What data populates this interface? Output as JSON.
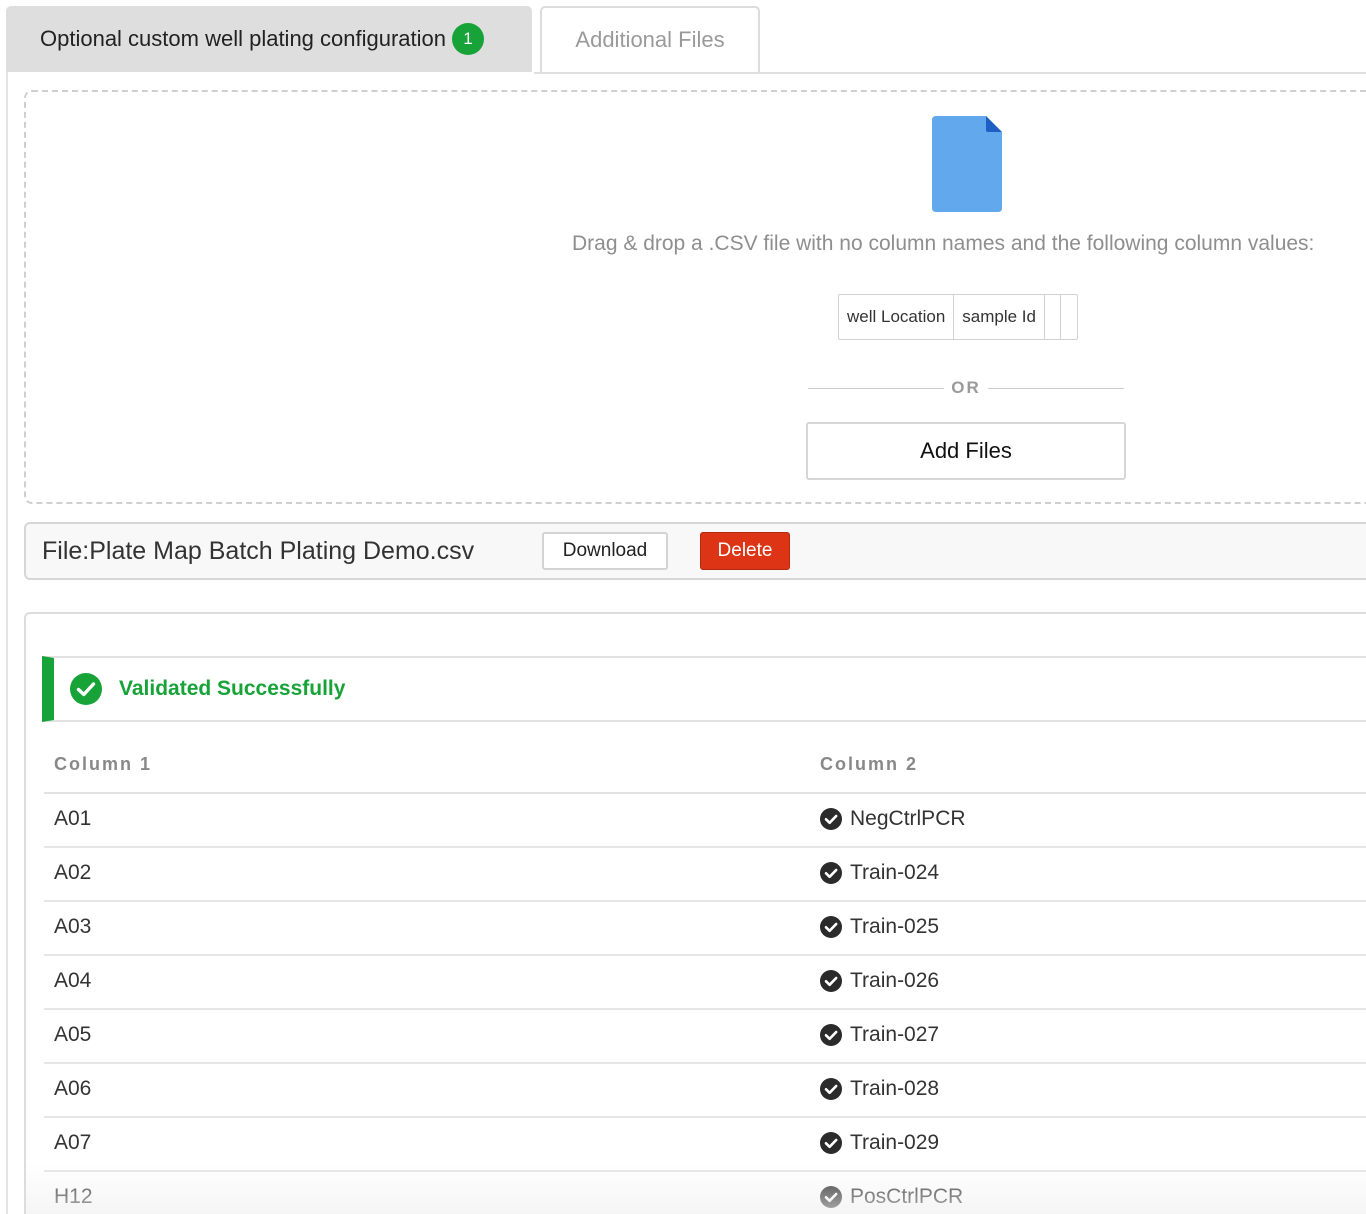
{
  "tabs": [
    {
      "label": "Optional custom well plating configuration",
      "badge": "1",
      "active": true
    },
    {
      "label": "Additional Files",
      "active": false
    }
  ],
  "dropzone": {
    "icon": "file-icon",
    "instruction": "Drag & drop a .CSV file with no column names and the following column values:",
    "columns": [
      "well Location",
      "sample Id",
      "",
      ""
    ],
    "or_label": "OR",
    "add_files_label": "Add Files"
  },
  "file_bar": {
    "file_label": "File:Plate Map Batch Plating Demo.csv",
    "download_label": "Download",
    "delete_label": "Delete"
  },
  "validation": {
    "message": "Validated Successfully",
    "icon": "check-circle-icon"
  },
  "table": {
    "headers": [
      "Column 1",
      "Column 2"
    ],
    "rows": [
      {
        "col1": "A01",
        "col2": "NegCtrlPCR"
      },
      {
        "col1": "A02",
        "col2": "Train-024"
      },
      {
        "col1": "A03",
        "col2": "Train-025"
      },
      {
        "col1": "A04",
        "col2": "Train-026"
      },
      {
        "col1": "A05",
        "col2": "Train-027"
      },
      {
        "col1": "A06",
        "col2": "Train-028"
      },
      {
        "col1": "A07",
        "col2": "Train-029"
      },
      {
        "col1": "H12",
        "col2": "PosCtrlPCR"
      }
    ]
  },
  "colors": {
    "success": "#17a338",
    "danger": "#dc3414",
    "file_icon": "#62a8ec"
  }
}
